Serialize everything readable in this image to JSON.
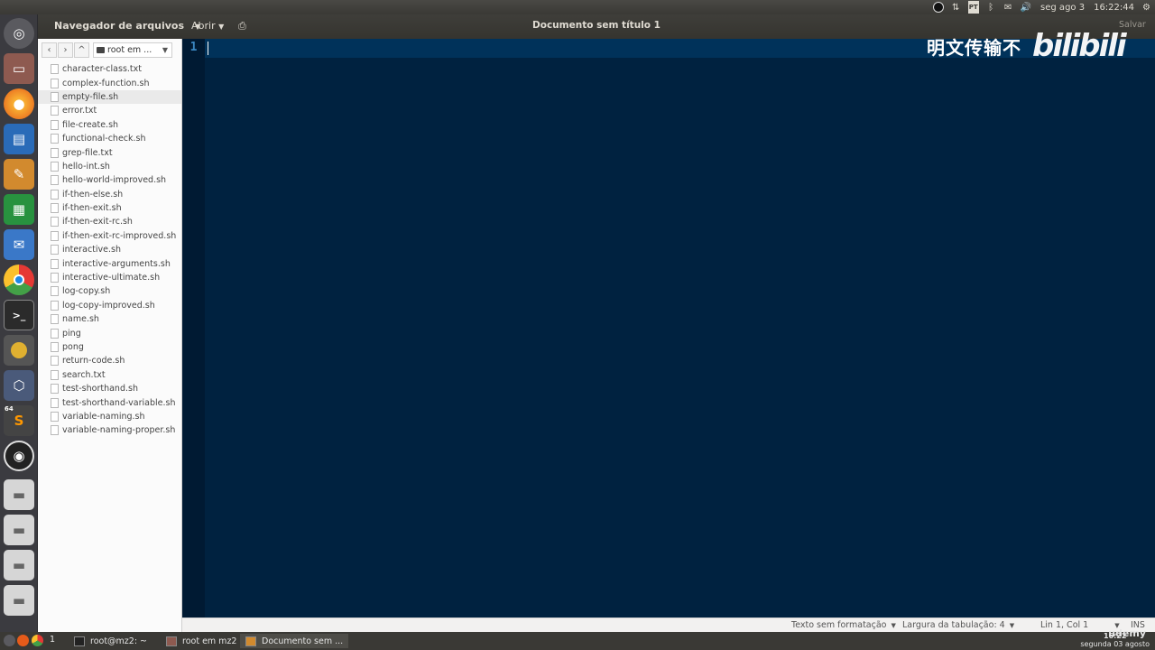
{
  "top_panel": {
    "indicators": [
      "obs-tray-icon",
      "network-arrows-icon",
      "pt-keyboard-icon",
      "bluetooth-icon",
      "mail-icon",
      "volume-icon"
    ],
    "pt_label": "PT",
    "date": "seg ago 3",
    "time": "16:22:44"
  },
  "header": {
    "file_browser_label": "Navegador de arquivos",
    "open_label": "Abrir",
    "doc_title": "Documento sem título 1",
    "save_label": "Salvar"
  },
  "sidebar": {
    "location": "root em ...",
    "files": [
      "character-class.txt",
      "complex-function.sh",
      "empty-file.sh",
      "error.txt",
      "file-create.sh",
      "functional-check.sh",
      "grep-file.txt",
      "hello-int.sh",
      "hello-world-improved.sh",
      "if-then-else.sh",
      "if-then-exit.sh",
      "if-then-exit-rc.sh",
      "if-then-exit-rc-improved.sh",
      "interactive.sh",
      "interactive-arguments.sh",
      "interactive-ultimate.sh",
      "log-copy.sh",
      "log-copy-improved.sh",
      "name.sh",
      "ping",
      "pong",
      "return-code.sh",
      "search.txt",
      "test-shorthand.sh",
      "test-shorthand-variable.sh",
      "variable-naming.sh",
      "variable-naming-proper.sh"
    ],
    "selected_index": 2
  },
  "editor": {
    "line_number": "1",
    "bg_color": "#002240"
  },
  "status_bar": {
    "format": "Texto sem formatação",
    "tab_width": "Largura da tabulação: 4",
    "position": "Lin 1, Col 1",
    "mode": "INS"
  },
  "launcher": {
    "icons": [
      "ubuntu-dash-icon",
      "files-icon",
      "firefox-icon",
      "writer-icon",
      "text-editor-icon",
      "calc-icon",
      "thunderbird-icon",
      "chrome-icon",
      "terminal-icon",
      "rhythmbox-icon",
      "virtualbox-icon",
      "sublime-icon",
      "obs-icon",
      "drive-icon-1",
      "drive-icon-2",
      "drive-icon-3",
      "drive-icon-4"
    ],
    "sublime_badge": "64"
  },
  "taskbar": {
    "workspace_number": "1",
    "tasks": [
      {
        "name": "terminal-task",
        "label": "root@mz2: ~"
      },
      {
        "name": "files-task",
        "label": "root em mz2"
      },
      {
        "name": "gedit-task",
        "label": "Documento sem ..."
      }
    ],
    "time_short": "16:22",
    "date_long": "segunda 03 agosto"
  },
  "watermark": {
    "text": "明文传输不",
    "logo": "bilibili",
    "udemy": "udemy"
  }
}
